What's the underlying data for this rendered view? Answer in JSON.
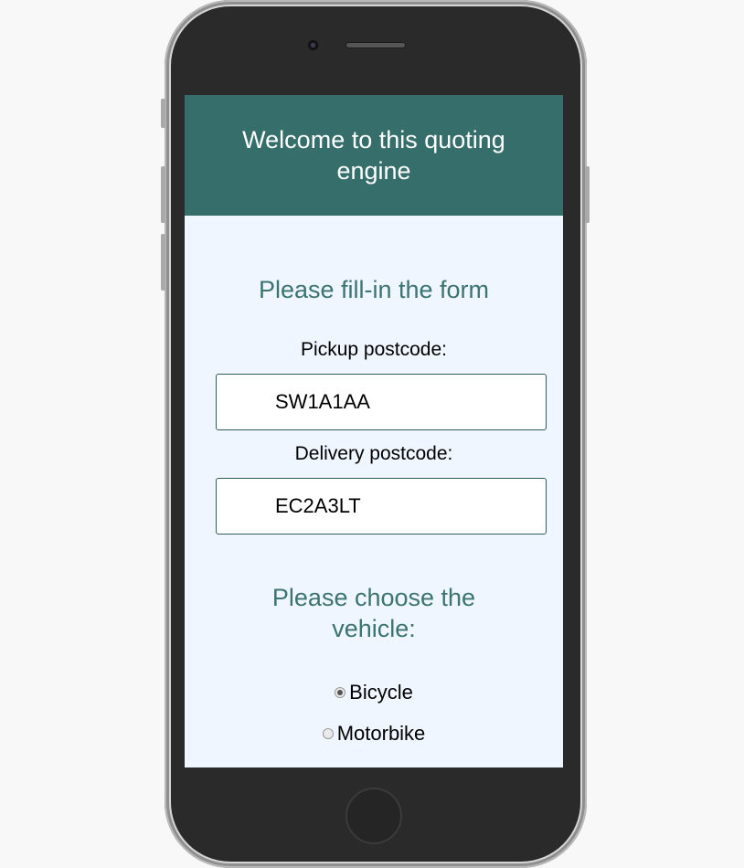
{
  "header": {
    "title": "Welcome to this quoting engine"
  },
  "form": {
    "title": "Please fill-in the form",
    "pickup_label": "Pickup postcode:",
    "pickup_value": "SW1A1AA",
    "delivery_label": "Delivery postcode:",
    "delivery_value": "EC2A3LT"
  },
  "vehicle": {
    "title": "Please choose the vehicle:",
    "options": [
      {
        "label": "Bicycle",
        "selected": true
      },
      {
        "label": "Motorbike",
        "selected": false
      }
    ]
  },
  "colors": {
    "header_bg": "#356e6b",
    "accent_text": "#3c7472",
    "screen_bg": "#eff6ff"
  }
}
